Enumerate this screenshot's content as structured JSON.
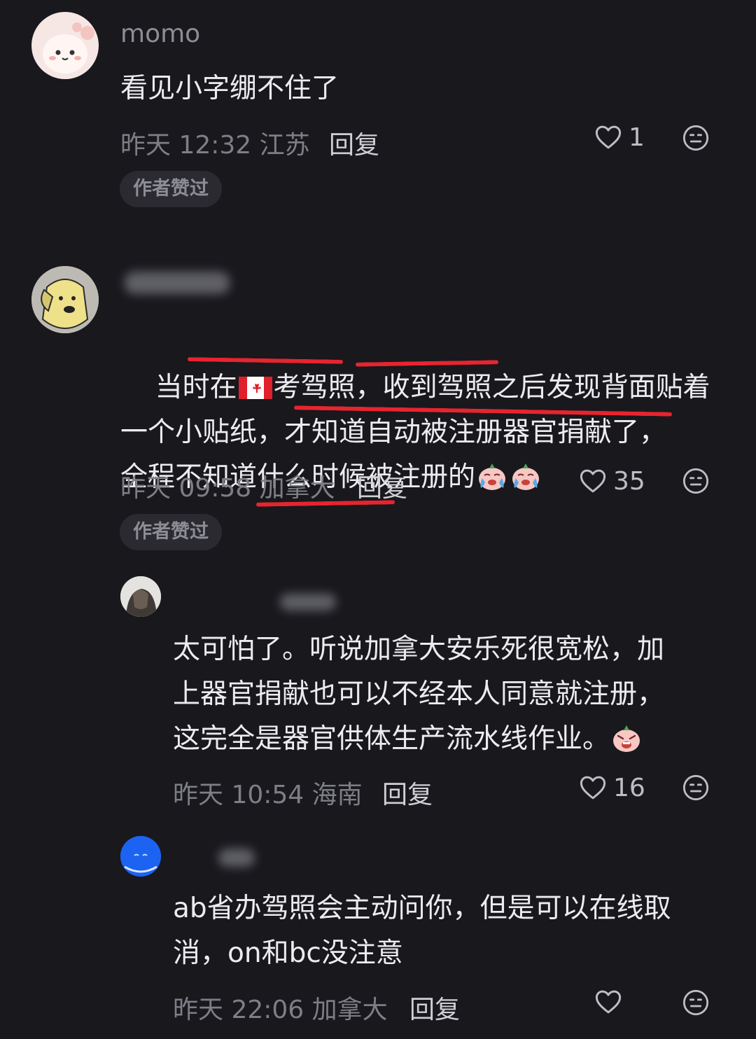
{
  "comments": [
    {
      "user": "momo",
      "text": "看见小字绷不住了",
      "time": "昨天 12:32",
      "location": "江苏",
      "reply": "回复",
      "likes": "1",
      "badge": "作者赞过"
    },
    {
      "user": "",
      "text_a": "当时在",
      "text_b": "考驾照，收到驾照之后发现背面贴着\n一个小贴纸，才知道自动被注册器官捐献了，\n全程不知道什么时候被注册的",
      "time": "昨天 09:58",
      "location": "加拿大",
      "reply": "回复",
      "likes": "35",
      "badge": "作者赞过"
    },
    {
      "user": "",
      "text": "太可怕了。听说加拿大安乐死很宽松，加\n上器官捐献也可以不经本人同意就注册，\n这完全是器官供体生产流水线作业。",
      "time": "昨天 10:54",
      "location": "海南",
      "reply": "回复",
      "likes": "16"
    },
    {
      "user": "",
      "text": "ab省办驾照会主动问你，但是可以在线取\n消，on和bc没注意",
      "time": "昨天 22:06",
      "location": "加拿大",
      "reply": "回复",
      "likes": ""
    }
  ],
  "colors": {
    "background": "#18181d",
    "highlight_underline": "#e8242e",
    "badge_bg": "#2a2a30"
  },
  "icons": [
    "heart-icon",
    "emoji-reaction-icon",
    "canada-flag-icon",
    "crying-emoji-icon",
    "scared-emoji-icon"
  ]
}
